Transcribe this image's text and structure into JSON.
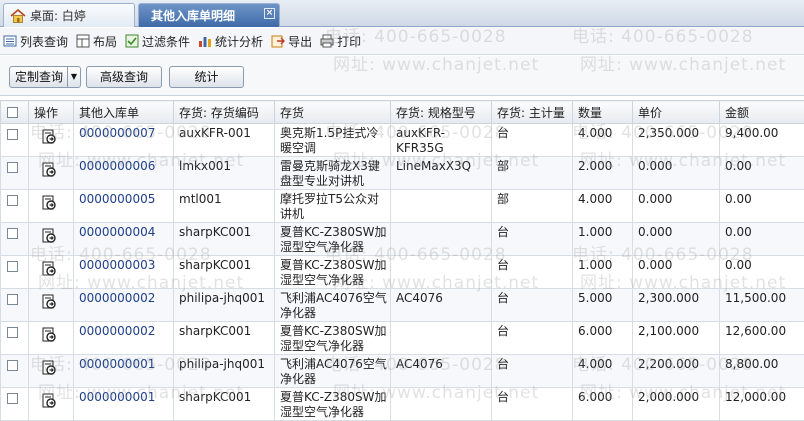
{
  "tabs": {
    "home_label": "桌面: 白婷",
    "active_label": "其他入库单明细",
    "close_symbol": "×"
  },
  "toolbar": {
    "items": [
      {
        "label": "列表查询",
        "icon": "list-icon"
      },
      {
        "label": "布局",
        "icon": "layout-icon"
      },
      {
        "label": "过滤条件",
        "icon": "filter-icon"
      },
      {
        "label": "统计分析",
        "icon": "chart-icon"
      },
      {
        "label": "导出",
        "icon": "export-icon"
      },
      {
        "label": "打印",
        "icon": "print-icon"
      }
    ]
  },
  "buttons": {
    "custom_query": "定制查询",
    "advanced_query": "高级查询",
    "statistics": "统计"
  },
  "table": {
    "headers": [
      "操作",
      "其他入库单",
      "存货: 存货编码",
      "存货",
      "存货: 规格型号",
      "存货: 主计量",
      "数量",
      "单价",
      "金额"
    ],
    "rows": [
      {
        "doc": "0000000007",
        "code": "auxKFR-001",
        "name": "奥克斯1.5P挂式冷暖空调",
        "spec": "auxKFR-KFR35G",
        "unit": "台",
        "qty": "4.000",
        "price": "2,350.000",
        "amount": "9,400.00"
      },
      {
        "doc": "0000000006",
        "code": "lmkx001",
        "name": "雷曼克斯骑龙X3键盘型专业对讲机",
        "spec": "LineMaxX3Q",
        "unit": "部",
        "qty": "2.000",
        "price": "0.000",
        "amount": "0.00"
      },
      {
        "doc": "0000000005",
        "code": "mtl001",
        "name": "摩托罗拉T5公众对讲机",
        "spec": "",
        "unit": "部",
        "qty": "4.000",
        "price": "0.000",
        "amount": "0.00"
      },
      {
        "doc": "0000000004",
        "code": "sharpKC001",
        "name": "夏普KC-Z380SW加湿型空气净化器",
        "spec": "",
        "unit": "台",
        "qty": "1.000",
        "price": "0.000",
        "amount": "0.00"
      },
      {
        "doc": "0000000003",
        "code": "sharpKC001",
        "name": "夏普KC-Z380SW加湿型空气净化器",
        "spec": "",
        "unit": "台",
        "qty": "1.000",
        "price": "0.000",
        "amount": "0.00"
      },
      {
        "doc": "0000000002",
        "code": "philipa-jhq001",
        "name": "飞利浦AC4076空气净化器",
        "spec": "AC4076",
        "unit": "台",
        "qty": "5.000",
        "price": "2,300.000",
        "amount": "11,500.00"
      },
      {
        "doc": "0000000002",
        "code": "sharpKC001",
        "name": "夏普KC-Z380SW加湿型空气净化器",
        "spec": "",
        "unit": "台",
        "qty": "6.000",
        "price": "2,100.000",
        "amount": "12,600.00"
      },
      {
        "doc": "0000000001",
        "code": "philipa-jhq001",
        "name": "飞利浦AC4076空气净化器",
        "spec": "AC4076",
        "unit": "台",
        "qty": "4.000",
        "price": "2,200.000",
        "amount": "8,800.00"
      },
      {
        "doc": "0000000001",
        "code": "sharpKC001",
        "name": "夏普KC-Z380SW加湿型空气净化器",
        "spec": "",
        "unit": "台",
        "qty": "6.000",
        "price": "2,000.000",
        "amount": "12,000.00"
      }
    ]
  },
  "watermark": {
    "phone": "电话: 400-665-0028",
    "site": "网址: www.chanjet.net"
  }
}
